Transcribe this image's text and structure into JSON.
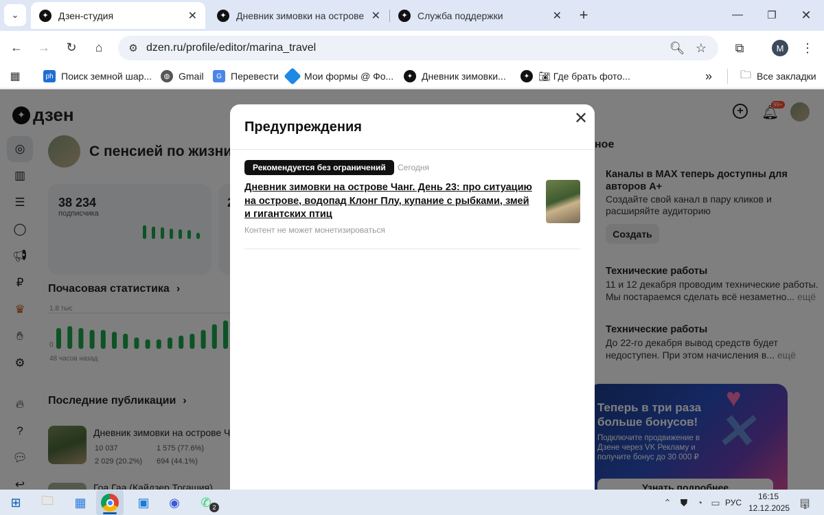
{
  "browser": {
    "tabs": [
      {
        "label": "Дзен-студия",
        "active": true
      },
      {
        "label": "Дневник зимовки на острове",
        "active": false
      },
      {
        "label": "Служба поддержки",
        "active": false
      }
    ],
    "new_tab_symbol": "+",
    "url": "dzen.ru/profile/editor/marina_travel",
    "profile_initial": "M",
    "bookmarks": [
      {
        "label": "Поиск земной шар...",
        "icon": "ph-icon"
      },
      {
        "label": "Gmail",
        "icon": "globe-icon"
      },
      {
        "label": "Перевести",
        "icon": "translate-icon"
      },
      {
        "label": "Мои формы @ Фо...",
        "icon": "forms-icon"
      },
      {
        "label": "Дневник зимовки...",
        "icon": "dzen-icon"
      },
      {
        "label": "Где брать фото...",
        "icon": "dzen-icon"
      }
    ],
    "all_bookmarks": "Все закладки",
    "more_symbol": "»"
  },
  "dzen": {
    "logo": "дзен",
    "channel_name": "С пенсией по жизни",
    "subscribers_value": "38 234",
    "subscribers_label": "подписчика",
    "stat2_value_partial": "2",
    "hourly_title": "Почасовая статистика",
    "hourly_ymax": "1.8 тыс",
    "hourly_y0": "0",
    "hourly_xlabel": "48 часов назад",
    "hourly_bars": [
      0.55,
      0.6,
      0.55,
      0.5,
      0.5,
      0.45,
      0.4,
      0.3,
      0.25,
      0.25,
      0.3,
      0.35,
      0.4,
      0.5,
      0.65,
      0.75
    ],
    "recent_title": "Последние публикации",
    "recent_item_title": "Дневник зимовки на острове Ч",
    "recent_stats": [
      "10 037",
      "1 575 (77.6%)",
      "2 029 (20.2%)",
      "694 (44.1%)"
    ],
    "recent_item2_title": "Гоа Гаа (Кайдзер Тогашия)",
    "notif_header": "ное",
    "notifications": [
      {
        "title": "Каналы в MAX теперь доступны для авторов A+",
        "text": "Создайте свой канал в пару кликов и расширяйте аудиторию",
        "button": "Создать"
      },
      {
        "title": "Технические работы",
        "text": "11 и 12 декабря проводим технические работы. Мы постараемся сделать всё незаметно...",
        "more": "ещё"
      },
      {
        "title": "Технические работы",
        "text": "До 22-го декабря вывод средств будет недоступен. При этом начисления в...",
        "more": "ещё"
      }
    ],
    "notif_count": "99+",
    "promo": {
      "title": "Теперь в три раза больше бонусов!",
      "text": "Подключите продвижение в Дзене через VK Рекламу и получите бонус до 30 000 ₽",
      "button": "Узнать подробнее"
    }
  },
  "modal": {
    "title": "Предупреждения",
    "badge": "Рекомендуется без ограничений",
    "date": "Сегодня",
    "article_title": "Дневник зимовки на острове Чанг. День 23: про ситуацию на острове, водопад Клонг Плу, купание с рыбками, змей и гигантских птиц",
    "note": "Контент не может монетизироваться"
  },
  "taskbar": {
    "lang": "РУС",
    "time": "16:15",
    "date": "12.12.2025",
    "whatsapp_badge": "2",
    "notif_badge": "1"
  }
}
